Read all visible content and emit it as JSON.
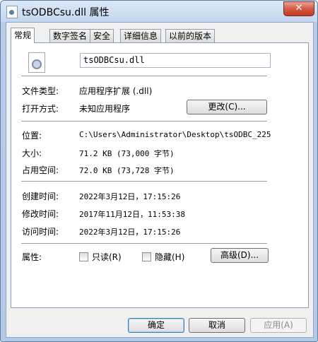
{
  "window": {
    "title": "tsODBCsu.dll 属性",
    "close_label": "✕"
  },
  "tabs": [
    "常规",
    "数字签名",
    "安全",
    "详细信息",
    "以前的版本"
  ],
  "general": {
    "filename": "tsODBCsu.dll",
    "file_type_label": "文件类型:",
    "file_type_value": "应用程序扩展 (.dll)",
    "opens_with_label": "打开方式:",
    "opens_with_value": "未知应用程序",
    "change_button": "更改(C)...",
    "location_label": "位置:",
    "location_value": "C:\\Users\\Administrator\\Desktop\\tsODBC_225",
    "size_label": "大小:",
    "size_value": "71.2 KB (73,000 字节)",
    "size_on_disk_label": "占用空间:",
    "size_on_disk_value": "72.0 KB (73,728 字节)",
    "created_label": "创建时间:",
    "created_value": "2022年3月12日，17:15:26",
    "modified_label": "修改时间:",
    "modified_value": "2017年11月12日，11:53:38",
    "accessed_label": "访问时间:",
    "accessed_value": "2022年3月12日，17:15:26",
    "attributes_label": "属性:",
    "readonly_label": "只读(R)",
    "hidden_label": "隐藏(H)",
    "advanced_button": "高级(D)..."
  },
  "footer": {
    "ok": "确定",
    "cancel": "取消",
    "apply": "应用(A)"
  }
}
